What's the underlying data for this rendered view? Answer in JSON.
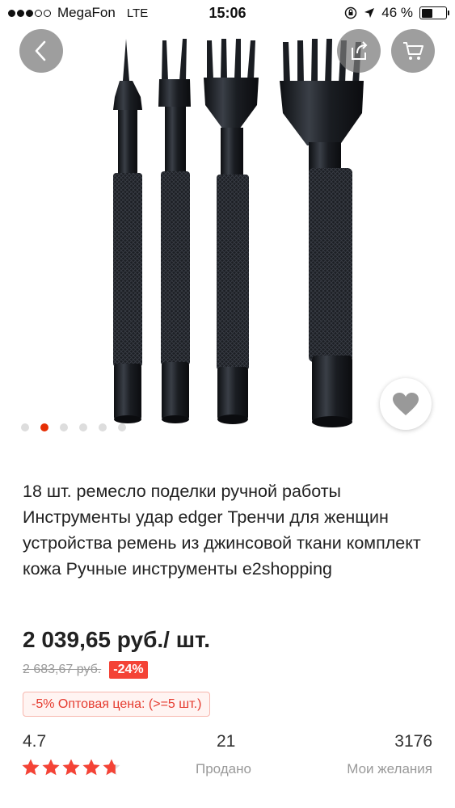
{
  "status_bar": {
    "carrier": "MegaFon",
    "network": "LTE",
    "time": "15:06",
    "battery": "46 %",
    "battery_level": 0.46,
    "signal_bars": 3,
    "signal_total": 5
  },
  "gallery": {
    "image_count": 6,
    "active_index": 1,
    "icons": {
      "back": "chevron-left-icon",
      "share": "share-icon",
      "cart": "cart-icon",
      "favorite": "heart-icon"
    }
  },
  "product": {
    "title": "18 шт. ремесло поделки ручной работы Инструменты удар edger Тренчи для женщин устройства ремень из джинсовой ткани комплект кожа Ручные инструменты e2shopping",
    "price": "2 039,65 руб./ шт.",
    "old_price": "2 683,67 руб.",
    "discount": "-24%",
    "wholesale": "-5% Оптовая цена: (>=5 шт.)"
  },
  "stats": {
    "rating": "4.7",
    "rating_value": 4.7,
    "sold_count": "21",
    "sold_label": "Продано",
    "wishlist_count": "3176",
    "wishlist_label": "Мои желания"
  },
  "colors": {
    "accent": "#e62e04",
    "star": "#f44336",
    "discount_bg": "#f44336",
    "wholesale_text": "#e53a2e"
  }
}
